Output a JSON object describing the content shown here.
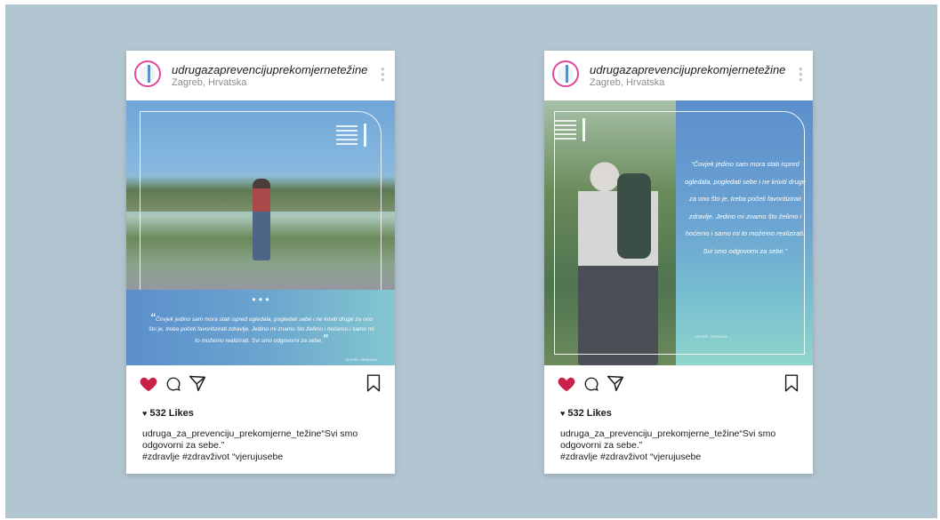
{
  "posts": [
    {
      "handle": "udrugazaprevencijuprekomjernetežine",
      "location": "Zagreb, Hrvatska",
      "quote": "Čovjek jedino sam mora stati ispred ogledala, pogledati sebe i ne kriviti druge za ono što je, treba početi favoritizirati zdravlje. Jedino mi znamo što želimo i hoćemo i samo mi to možemo realizirati. Svi smo odgovorni za sebe.",
      "author": "IZVOR: UDRUGA",
      "likes": "532 Likes",
      "caption_user": "udruga_za_prevenciju_prekomjerne_težine",
      "caption_text": "“Svi smo odgovorni za sebe.”",
      "hashtags": "#zdravlje #zdravživot “vjerujusebe"
    },
    {
      "handle": "udrugazaprevencijuprekomjernetežine",
      "location": "Zagreb, Hrvatska",
      "quote": "“Čovjek jedino sam mora stati ispred ogledala, pogledati sebe i ne kriviti druge za ono što je, treba početi favoritizirati zdravlje. Jedino mi znamo što želimo i hoćemo i samo mi to možemo realizirati. Svi smo odgovorni za sebe.”",
      "author": "IZVOR: UDRUGA",
      "likes": "532 Likes",
      "caption_user": "udruga_za_prevenciju_prekomjerne_težine",
      "caption_text": "“Svi smo odgovorni za sebe.”",
      "hashtags": "#zdravlje #zdravživot “vjerujusebe"
    }
  ],
  "icons": [
    "heart-icon",
    "comment-icon",
    "send-icon",
    "bookmark-icon",
    "more-icon"
  ],
  "colors": {
    "background": "#b2c6d2",
    "heart": "#c8224a",
    "avatar_ring": "#e0489a",
    "band_start": "#5b8fcb",
    "band_end": "#84c7cf"
  }
}
